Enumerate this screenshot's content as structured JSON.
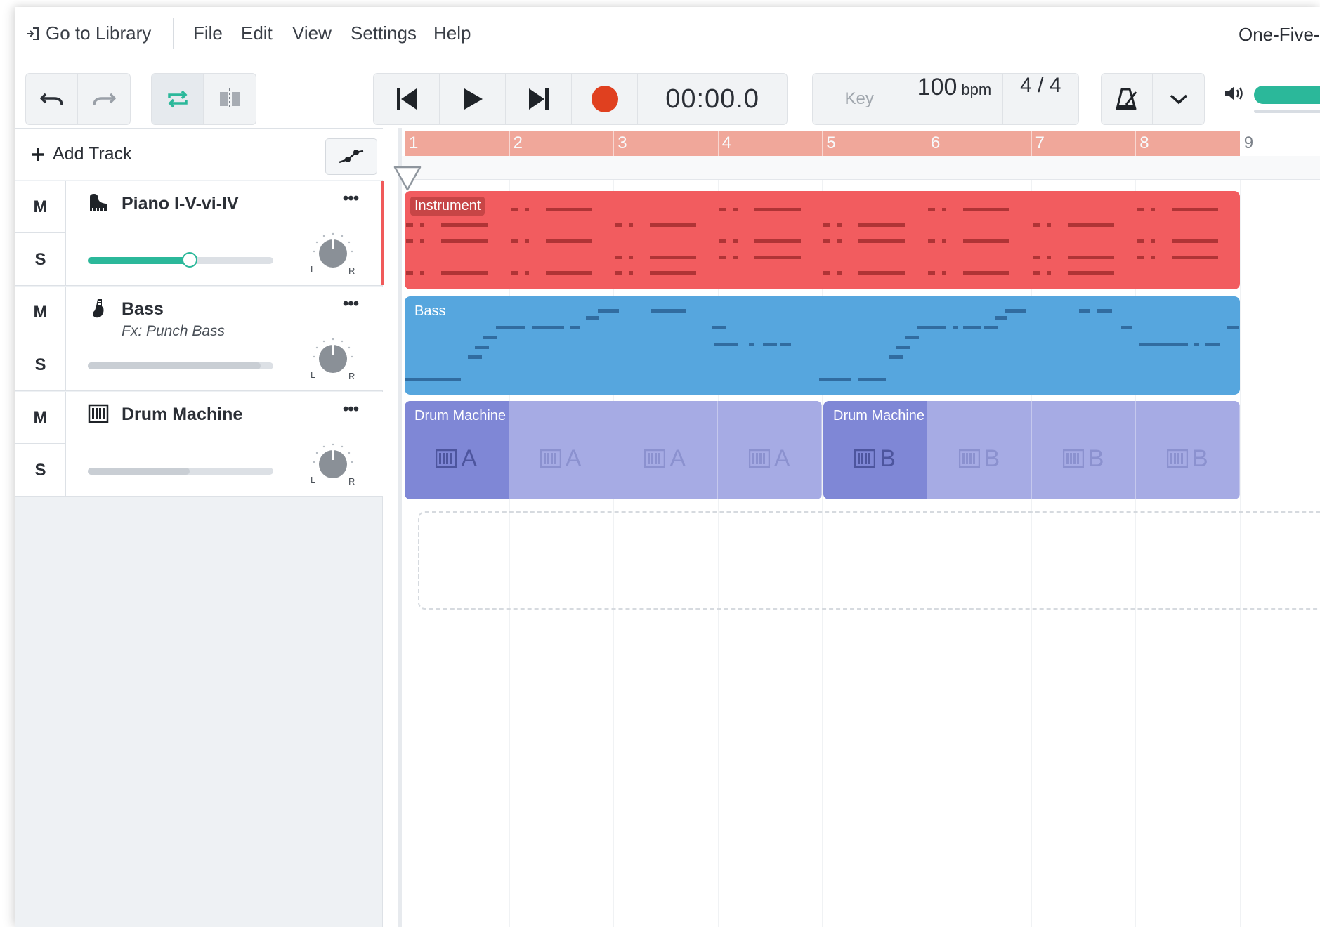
{
  "menubar": {
    "library_label": "Go to Library",
    "items": [
      "File",
      "Edit",
      "View",
      "Settings",
      "Help"
    ],
    "song_title": "One-Five-"
  },
  "transport": {
    "time": "00:00.0",
    "key_placeholder": "Key",
    "tempo_value": "100",
    "tempo_unit": "bpm",
    "time_signature": "4 / 4",
    "record_color": "#e0401f"
  },
  "panel": {
    "add_track_label": "Add Track"
  },
  "tracks": [
    {
      "name": "Piano I-V-vi-IV",
      "subtitle": "",
      "icon": "piano-icon",
      "mute_label": "M",
      "solo_label": "S",
      "more_label": "•••",
      "volume": 0.55,
      "volume_color": "#2bb89a",
      "selected": true
    },
    {
      "name": "Bass",
      "subtitle": "Fx: Punch Bass",
      "icon": "bass-guitar-icon",
      "mute_label": "M",
      "solo_label": "S",
      "more_label": "•••",
      "volume": 0.93,
      "volume_color": "#c9ced4",
      "selected": false
    },
    {
      "name": "Drum Machine",
      "subtitle": "",
      "icon": "drum-machine-icon",
      "mute_label": "M",
      "solo_label": "S",
      "more_label": "•••",
      "volume": 0.55,
      "volume_color": "#c9ced4",
      "selected": false
    }
  ],
  "pan_labels": {
    "left": "L",
    "right": "R"
  },
  "ruler": {
    "bars": [
      "1",
      "2",
      "3",
      "4",
      "5",
      "6",
      "7",
      "8",
      "9"
    ],
    "loop_color": "#f0a79a"
  },
  "clips": {
    "piano": {
      "label": "Instrument",
      "color": "#f25c5f"
    },
    "bass": {
      "label": "Bass",
      "color": "#56a6de"
    },
    "drums": [
      {
        "label": "Drum Machine",
        "pattern": "A",
        "repeats": [
          "A",
          "A",
          "A"
        ],
        "color": "#7f87d6",
        "repeat_color": "#a6abe4"
      },
      {
        "label": "Drum Machine",
        "pattern": "B",
        "repeats": [
          "B",
          "B",
          "B"
        ],
        "color": "#7f87d6",
        "repeat_color": "#a6abe4"
      }
    ]
  },
  "accent": "#2bb89a"
}
